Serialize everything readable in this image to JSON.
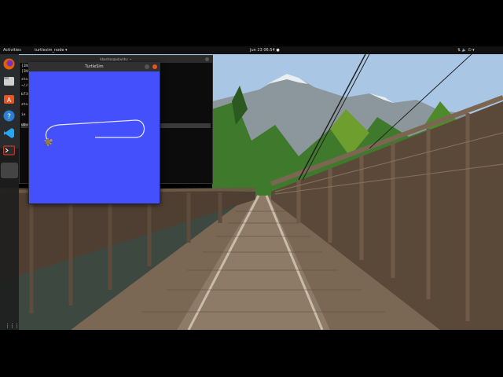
{
  "topbar": {
    "activities": "Activities",
    "app_menu": "turtlesim_node ▾",
    "clock": "Jun 23  06:54 ●",
    "tray": "⇅  🔈  ⏻ ▾"
  },
  "dock": {
    "items": [
      {
        "name": "firefox-icon",
        "color": "#e66000"
      },
      {
        "name": "files-icon",
        "color": "#888888"
      },
      {
        "name": "software-icon",
        "color": "#e95420"
      },
      {
        "name": "help-icon",
        "color": "#2a7fd4"
      },
      {
        "name": "vscode-icon",
        "color": "#23a9f2"
      },
      {
        "name": "terminal-icon",
        "color": "#c0392b"
      }
    ],
    "apps_grid": "⋮⋮⋮"
  },
  "terminal": {
    "title": "kbashas@ubuntu: ~",
    "lines": [
      "[INFO]  ...                    ubuntu:11311/",
      "[INFO]  ...                    ~ster",
      "                               started with pid [3967",
      "                               ~//ubuntu:11311/",
      "                               b730e60a-ef0b-11f1-8",
      "",
      "                               started with pid [39",
      "",
      "",
      "                               ie [/rosout]",
      "",
      "                               ubuntu:~39x11"
    ],
    "highlight_index": 11
  },
  "turtlesim": {
    "title": "TurtleSim",
    "background": "#4550fd"
  },
  "wallpaper": {
    "sky": "#a9c6e4",
    "mountains": "#9aa6ae",
    "forest": "#3f7a2c",
    "bridge": "#6e5a47"
  }
}
